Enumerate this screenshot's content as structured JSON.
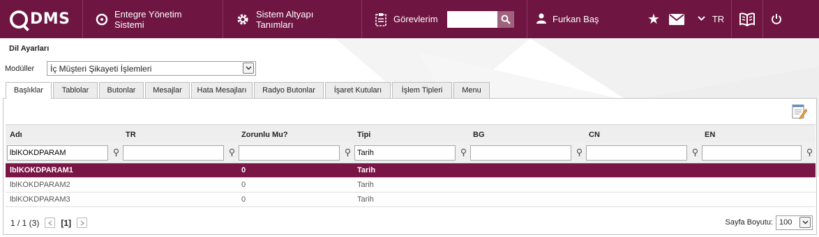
{
  "brand": {
    "logo_text": "DMS",
    "color": "#6e1541"
  },
  "nav": {
    "main_system": "Entegre Yönetim Sistemi",
    "infra": "Sistem Altyapı Tanımları",
    "tasks": "Görevlerim",
    "search_placeholder": "",
    "user_name": "Furkan Baş",
    "language": "TR",
    "icons": [
      "star-icon",
      "mail-icon",
      "chevron-down-icon",
      "book-icon",
      "power-icon"
    ]
  },
  "page": {
    "title": "Dil Ayarları",
    "module_label": "Modüller",
    "module_value": "İç Müşteri Şikayeti İşlemleri"
  },
  "tabs": [
    {
      "label": "Başlıklar",
      "active": true
    },
    {
      "label": "Tablolar",
      "active": false
    },
    {
      "label": "Butonlar",
      "active": false
    },
    {
      "label": "Mesajlar",
      "active": false
    },
    {
      "label": "Hata Mesajları",
      "active": false
    },
    {
      "label": "Radyo Butonlar",
      "active": false
    },
    {
      "label": "İşaret Kutuları",
      "active": false
    },
    {
      "label": "İşlem Tipleri",
      "active": false
    },
    {
      "label": "Menu",
      "active": false
    }
  ],
  "grid": {
    "columns": [
      "Adı",
      "TR",
      "Zorunlu Mu?",
      "Tipi",
      "BG",
      "CN",
      "EN"
    ],
    "filters": [
      "lblKOKDPARAM",
      "",
      "",
      "Tarih",
      "",
      "",
      ""
    ],
    "rows": [
      {
        "cells": [
          "lblKOKDPARAM1",
          "",
          "0",
          "Tarih",
          "",
          "",
          ""
        ],
        "selected": true
      },
      {
        "cells": [
          "lblKOKDPARAM2",
          "",
          "0",
          "Tarih",
          "",
          "",
          ""
        ],
        "selected": false
      },
      {
        "cells": [
          "lblKOKDPARAM3",
          "",
          "0",
          "Tarih",
          "",
          "",
          ""
        ],
        "selected": false
      }
    ],
    "selected_color": "#7a1646"
  },
  "pagination": {
    "info": "1 / 1 (3)",
    "current": "[1]",
    "page_size_label": "Sayfa Boyutu:",
    "page_size": "100"
  }
}
